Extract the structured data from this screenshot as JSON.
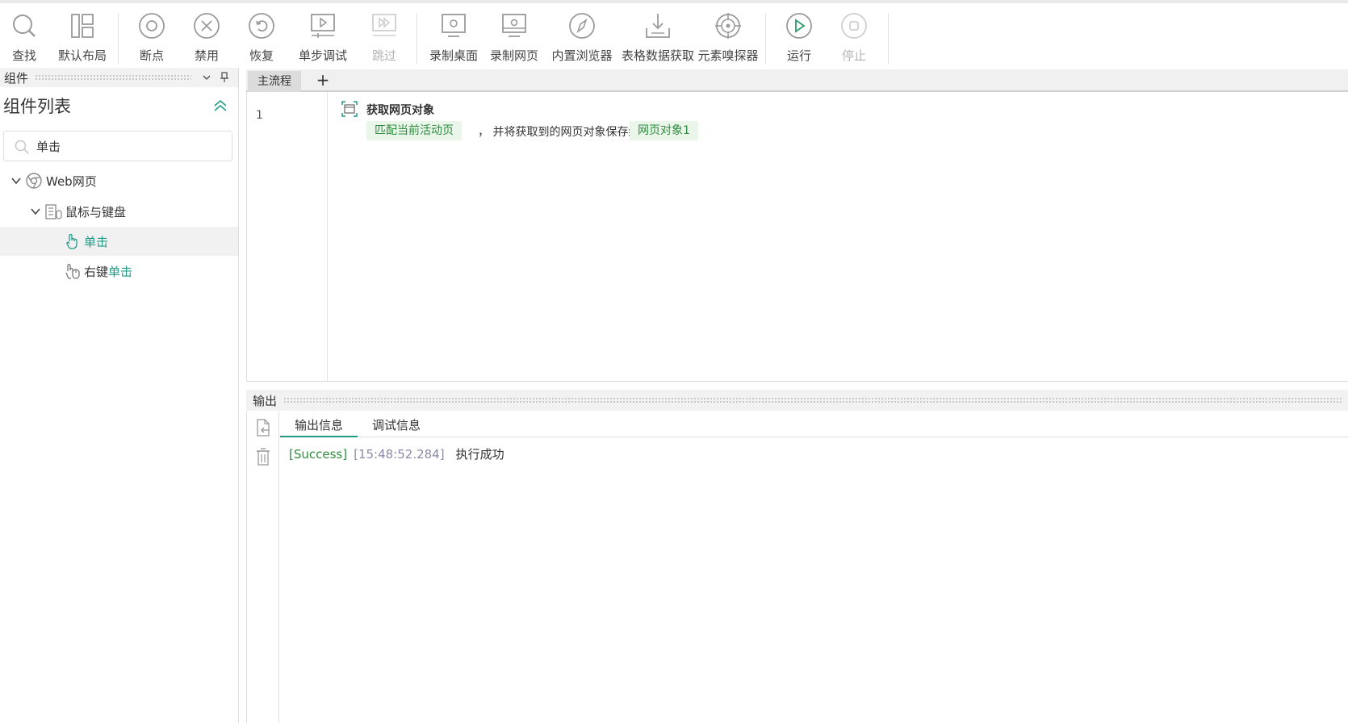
{
  "toolbar": {
    "find": "查找",
    "default_layout": "默认布局",
    "breakpoint": "断点",
    "disable": "禁用",
    "restore": "恢复",
    "step_debug": "单步调试",
    "skip": "跳过",
    "record_desktop": "录制桌面",
    "record_web": "录制网页",
    "builtin_browser": "内置浏览器",
    "table_data": "表格数据获取",
    "element_sniffer": "元素嗅探器",
    "run": "运行",
    "stop": "停止"
  },
  "components_panel": {
    "header": "组件",
    "title": "组件列表",
    "search_value": "单击",
    "tree": {
      "web": "Web网页",
      "mouse_keyboard": "鼠标与键盘",
      "click_match": "单击",
      "right_prefix": "右键",
      "right_match": "单击"
    }
  },
  "flow": {
    "tab_main": "主流程",
    "tab_add": "+",
    "line_number": "1",
    "step": {
      "title": "获取网页对象",
      "param_match": "匹配当前活动页",
      "text_mid": "，  并将获取到的网页对象保存给",
      "param_var": "网页对象1"
    }
  },
  "output": {
    "header": "输出",
    "tab_output": "输出信息",
    "tab_debug": "调试信息",
    "log": {
      "status": "[Success]",
      "time": "[15:48:52.284]",
      "message": "执行成功"
    }
  },
  "colors": {
    "accent": "#1f9a86",
    "success": "#2e8b3d",
    "param_bg": "#eaf6ea"
  }
}
